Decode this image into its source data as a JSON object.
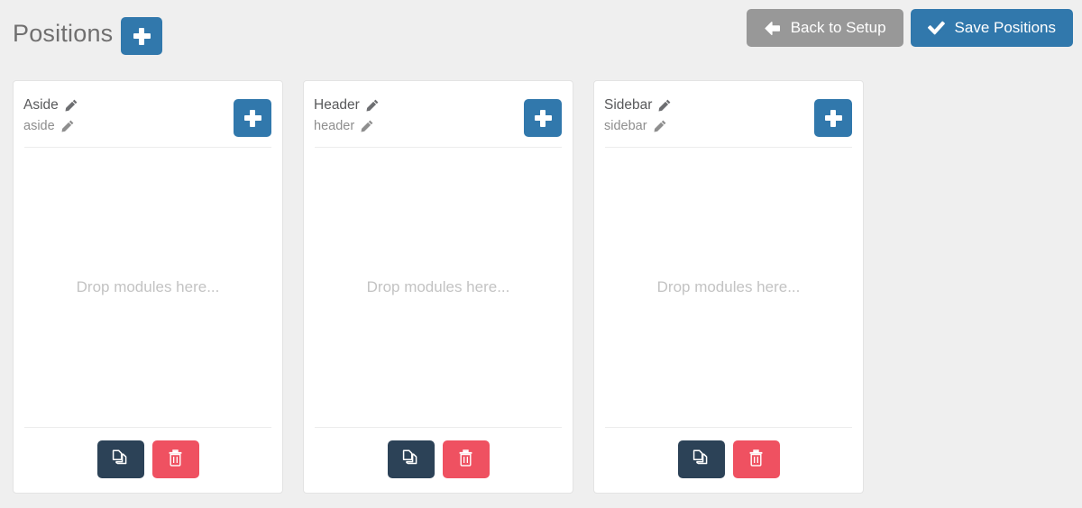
{
  "header": {
    "title": "Positions",
    "add_position_icon": "plus-icon",
    "actions": [
      {
        "label": "Back to Setup",
        "icon": "arrow-left-icon",
        "style": "secondary",
        "color": "#989898"
      },
      {
        "label": "Save Positions",
        "icon": "check-icon",
        "style": "primary",
        "color": "#3178ac"
      }
    ]
  },
  "theme": {
    "page_background": "#efefef",
    "accent_blue": "#3178ac",
    "dark_navy": "#2c4257",
    "danger_red": "#ef5161",
    "muted_gray": "#989898"
  },
  "dropzone_placeholder": "Drop modules here...",
  "card_actions": {
    "add_label": "",
    "add_icon": "plus-icon",
    "copy_icon": "copy-icon",
    "delete_icon": "trash-icon",
    "edit_icon": "pencil-icon"
  },
  "positions": [
    {
      "name": "Aside",
      "key": "aside"
    },
    {
      "name": "Header",
      "key": "header"
    },
    {
      "name": "Sidebar",
      "key": "sidebar"
    }
  ]
}
